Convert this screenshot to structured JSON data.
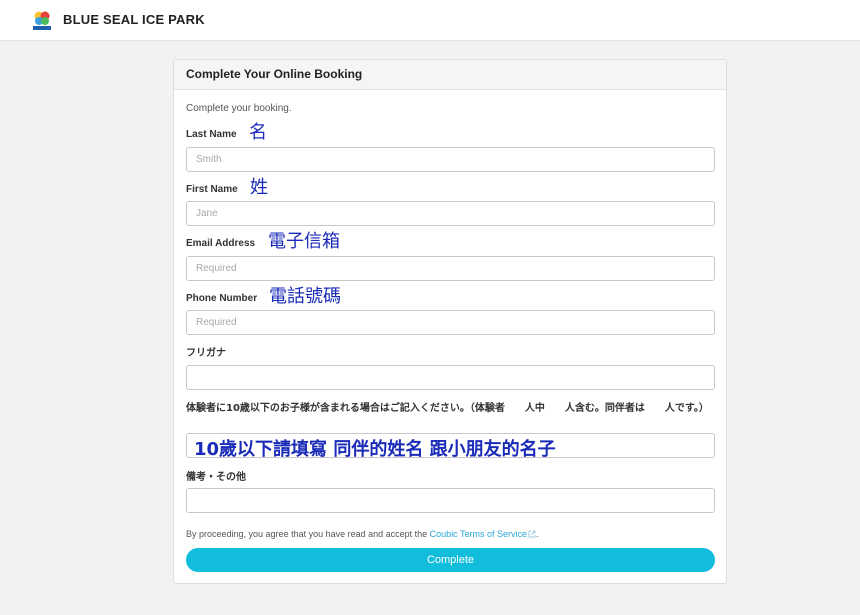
{
  "header": {
    "brand": "BLUE SEAL ICE PARK",
    "logo_icon": "blue-seal-logo-icon",
    "logo_colors": [
      "#f9c531",
      "#e8413c",
      "#3aa0df",
      "#4cb95a"
    ]
  },
  "card": {
    "title": "Complete Your Online Booking",
    "intro": "Complete your booking."
  },
  "form": {
    "last_name": {
      "label": "Last Name",
      "note": "名",
      "placeholder": "Smith"
    },
    "first_name": {
      "label": "First Name",
      "note": "姓",
      "placeholder": "Jane"
    },
    "email": {
      "label": "Email Address",
      "note": "電子信箱",
      "placeholder": "Required"
    },
    "phone": {
      "label": "Phone Number",
      "note": "電話號碼",
      "placeholder": "Required"
    },
    "furigana": {
      "label": "フリガナ",
      "placeholder": ""
    },
    "children": {
      "label": "体験者に10歳以下のお子様が含まれる場合はご記入ください。（体験者　　人中　　人含む。同伴者は　　人です。）",
      "note": "10歲以下請填寫 同伴的姓名 跟小朋友的名子"
    },
    "remarks": {
      "label": "備考・その他",
      "placeholder": ""
    }
  },
  "terms": {
    "prefix": "By proceeding, you agree that you have read and accept the ",
    "link": "Coubic Terms of Service",
    "suffix": "."
  },
  "submit_label": "Complete",
  "colors": {
    "accent": "#12bddc",
    "link": "#2aa7d6",
    "annotation": "#1a2bb8",
    "background": "#f2f2f2"
  }
}
